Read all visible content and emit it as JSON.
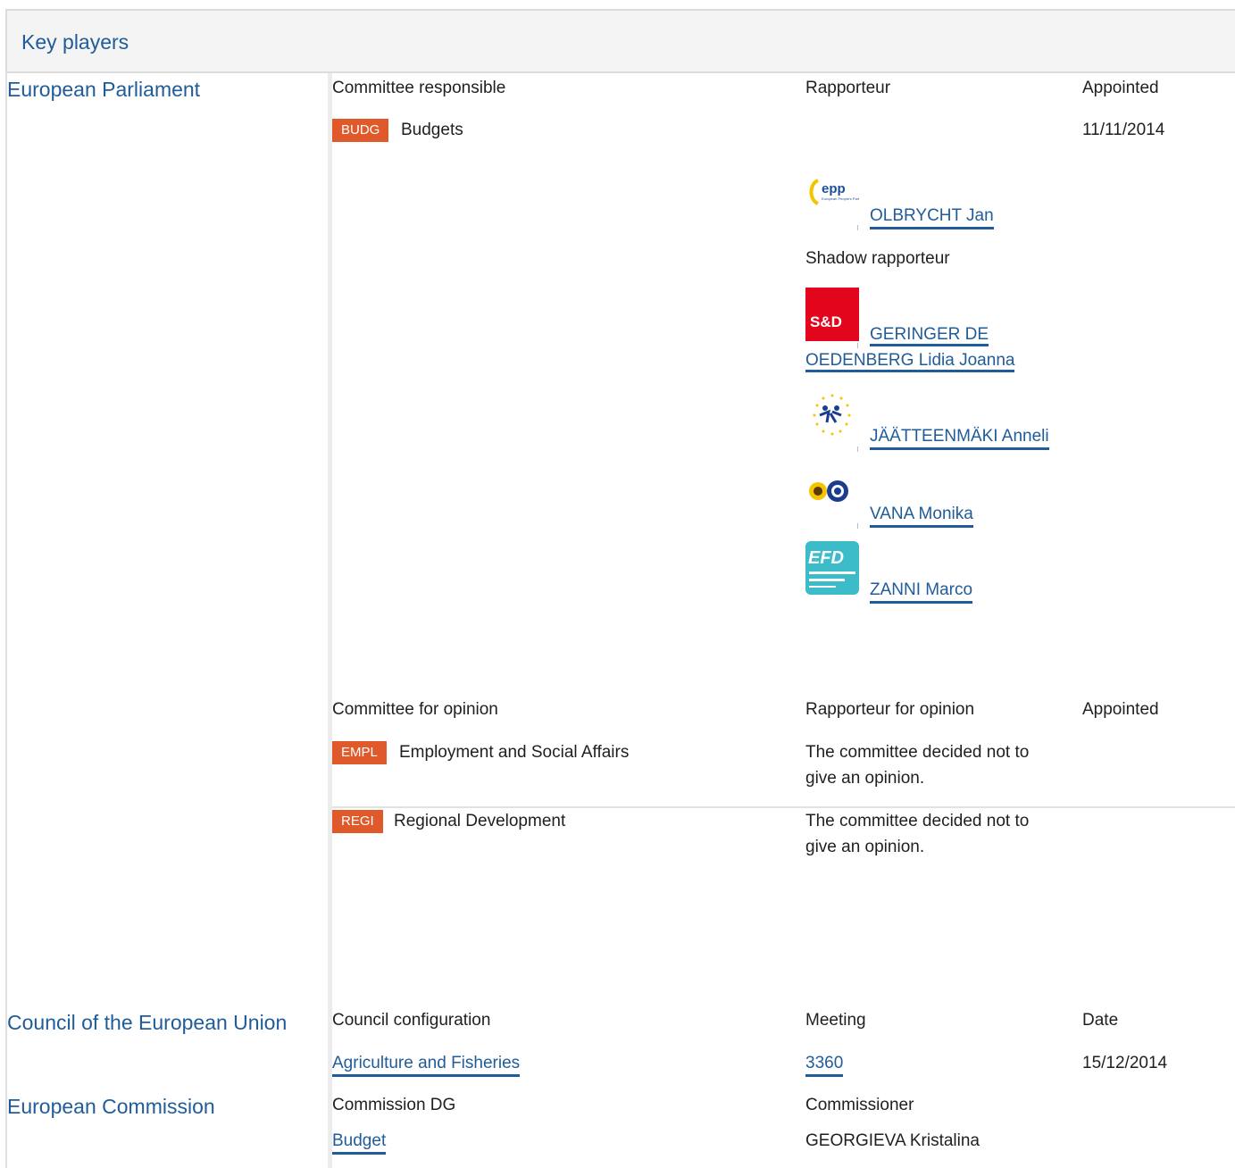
{
  "header": {
    "title": "Key players"
  },
  "ep": {
    "label": "European Parliament",
    "responsible": {
      "col_committee": "Committee responsible",
      "col_rapporteur": "Rapporteur",
      "col_appointed": "Appointed",
      "committee_code": "BUDG",
      "committee_name": "Budgets",
      "appointed": "11/11/2014",
      "rapporteur": {
        "group_logo": "epp-logo",
        "name": "OLBRYCHT Jan"
      },
      "shadow_label": "Shadow rapporteur",
      "shadows": [
        {
          "group_logo": "sd-logo",
          "line1": "GERINGER DE",
          "line2": "OEDENBERG Lidia Joanna"
        },
        {
          "group_logo": "alde-logo",
          "name": "JÄÄTTEENMÄKI Anneli"
        },
        {
          "group_logo": "greens-efa-logo",
          "name": "VANA Monika"
        },
        {
          "group_logo": "efd-logo",
          "name": "ZANNI Marco"
        }
      ]
    },
    "opinion": {
      "col_committee": "Committee for opinion",
      "col_rapporteur": "Rapporteur for opinion",
      "col_appointed": "Appointed",
      "rows": [
        {
          "code": "EMPL",
          "name": "Employment and Social Affairs",
          "line1": "The committee decided not to",
          "line2": "give an opinion."
        },
        {
          "code": "REGI",
          "name": "Regional Development",
          "line1": "The committee decided not to",
          "line2": "give an opinion."
        }
      ]
    }
  },
  "council": {
    "label": "Council of the European Union",
    "col_config": "Council configuration",
    "col_meeting": "Meeting",
    "col_date": "Date",
    "config": "Agriculture and Fisheries",
    "meeting": "3360",
    "date": "15/12/2014"
  },
  "commission": {
    "label": "European Commission",
    "col_dg": "Commission DG",
    "col_commissioner": "Commissioner",
    "dg": "Budget",
    "commissioner": "GEORGIEVA Kristalina"
  },
  "colors": {
    "link": "#1f5c99",
    "badge": "#e0592a"
  }
}
